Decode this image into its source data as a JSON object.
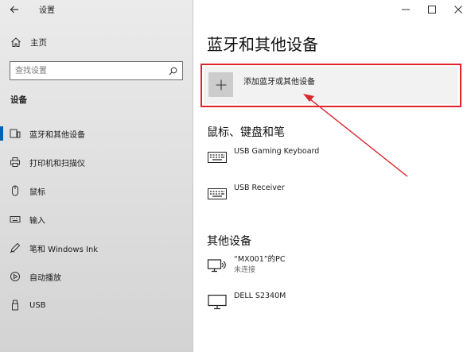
{
  "window": {
    "title": "设置",
    "controls": [
      "minimize",
      "maximize",
      "close"
    ]
  },
  "sidebar": {
    "home_label": "主页",
    "search_placeholder": "查找设置",
    "section_label": "设备",
    "items": [
      {
        "label": "蓝牙和其他设备",
        "icon": "bluetooth-devices-icon",
        "active": true
      },
      {
        "label": "打印机和扫描仪",
        "icon": "printer-icon",
        "active": false
      },
      {
        "label": "鼠标",
        "icon": "mouse-icon",
        "active": false
      },
      {
        "label": "输入",
        "icon": "keyboard-icon",
        "active": false
      },
      {
        "label": "笔和 Windows Ink",
        "icon": "pen-icon",
        "active": false
      },
      {
        "label": "自动播放",
        "icon": "autoplay-icon",
        "active": false
      },
      {
        "label": "USB",
        "icon": "usb-icon",
        "active": false
      }
    ]
  },
  "main": {
    "page_title": "蓝牙和其他设备",
    "add_device_label": "添加蓝牙或其他设备",
    "mouse_keyboard_pen": {
      "title": "鼠标、键盘和笔",
      "devices": [
        {
          "name": "USB Gaming Keyboard",
          "status": "",
          "icon": "keyboard-icon"
        },
        {
          "name": "USB Receiver",
          "status": "",
          "icon": "keyboard-icon"
        }
      ]
    },
    "other_devices": {
      "title": "其他设备",
      "devices": [
        {
          "name": "“MX001”的PC",
          "status": "未连接",
          "icon": "pc-wireless-icon"
        },
        {
          "name": "DELL S2340M",
          "status": "",
          "icon": "monitor-icon"
        }
      ]
    }
  },
  "annotation": {
    "highlight_color": "#e0242c",
    "arrow_color": "#d9262c"
  },
  "colors": {
    "accent": "#0063b1",
    "sidebar_bg": "#e4e4e4"
  }
}
